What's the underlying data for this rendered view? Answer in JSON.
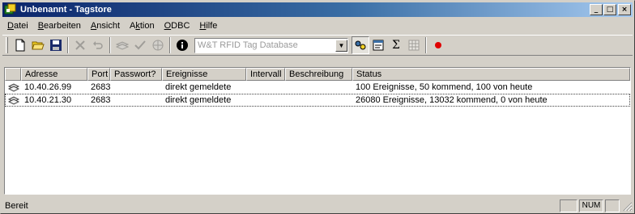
{
  "window": {
    "title": "Unbenannt - Tagstore"
  },
  "title_controls": {
    "minimize": "_",
    "maximize": "□",
    "close": "×"
  },
  "menu": [
    {
      "label": "Datei",
      "accel": "D",
      "rest": "atei"
    },
    {
      "label": "Bearbeiten",
      "accel": "B",
      "rest": "earbeiten"
    },
    {
      "label": "Ansicht",
      "accel": "A",
      "rest": "nsicht"
    },
    {
      "label": "Aktion",
      "pre": "A",
      "accel": "k",
      "rest": "tion"
    },
    {
      "label": "ODBC",
      "accel": "O",
      "rest": "DBC"
    },
    {
      "label": "Hilfe",
      "accel": "H",
      "rest": "ilfe"
    }
  ],
  "toolbar": {
    "database_combo": {
      "value": "W&T RFID Tag Database",
      "arrow": "▼"
    },
    "sum_glyph": "Σ"
  },
  "list": {
    "columns": [
      "",
      "Adresse",
      "Port",
      "Passwort?",
      "Ereignisse",
      "Intervall",
      "Beschreibung",
      "Status"
    ],
    "rows": [
      {
        "adresse": "10.40.26.99",
        "port": "2683",
        "passwort": "",
        "ereignisse": "direkt gemeldete",
        "intervall": "",
        "beschreibung": "",
        "status": "100 Ereignisse, 50 kommend, 100 von heute"
      },
      {
        "adresse": "10.40.21.30",
        "port": "2683",
        "passwort": "",
        "ereignisse": "direkt gemeldete",
        "intervall": "",
        "beschreibung": "",
        "status": "26080 Ereignisse, 13032 kommend, 0 von heute"
      }
    ]
  },
  "statusbar": {
    "text": "Bereit",
    "num": "NUM"
  },
  "colors": {
    "titlebar_start": "#0a246a",
    "titlebar_end": "#a6caf0",
    "face": "#d4d0c8",
    "record": "#e00000"
  }
}
